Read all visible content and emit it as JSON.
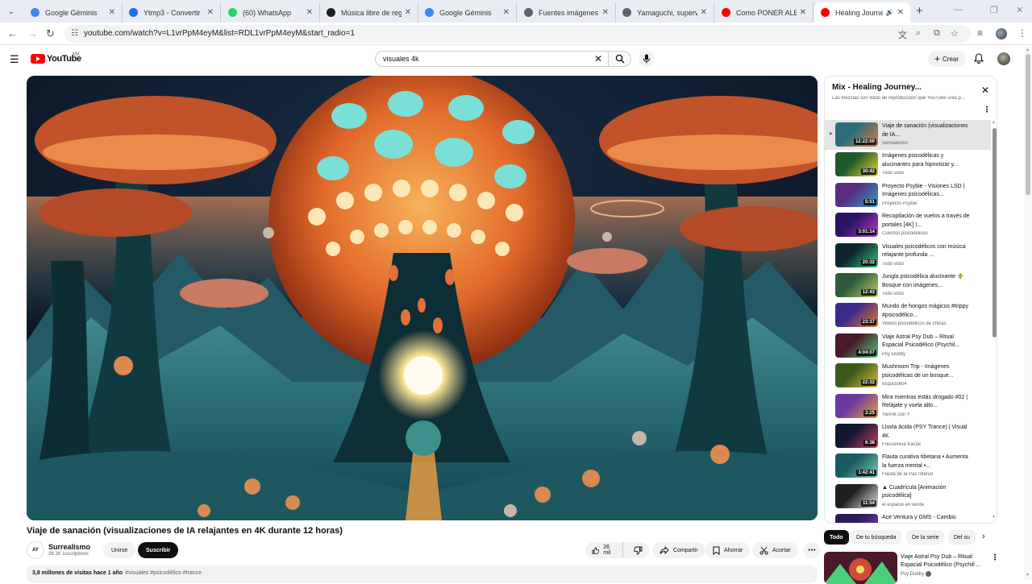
{
  "browser": {
    "tabs": [
      {
        "title": "Google Géminis",
        "color": "#4285f4"
      },
      {
        "title": "Ytmp3 - Convertir",
        "color": "#1a73e8"
      },
      {
        "title": "(60) WhatsApp",
        "color": "#25d366"
      },
      {
        "title": "Música libre de regal",
        "color": "#1f1f1f"
      },
      {
        "title": "Google Géminis",
        "color": "#4285f4"
      },
      {
        "title": "Fuentes imágenes Te",
        "color": "#5f6368"
      },
      {
        "title": "Yamaguchi, supervivie",
        "color": "#5f6368"
      },
      {
        "title": "Como PONER ALERTA",
        "color": "#ff0000"
      },
      {
        "title": "Healing Journey",
        "color": "#ff0000",
        "active": true
      }
    ],
    "url": "youtube.com/watch?v=L1vrPpM4eyM&list=RDL1vrPpM4eyM&start_radio=1"
  },
  "masthead": {
    "logo_text": "YouTube",
    "country": "MX",
    "search_value": "visuales 4k",
    "create_label": "Crear"
  },
  "video": {
    "title": "Viaje de sanación (visualizaciones de IA relajantes en 4K durante 12 horas)",
    "channel": "Surrealismo",
    "channel_logo_text": "AY",
    "subscribers": "38.1K suscriptores",
    "join_label": "Unirse",
    "subscribe_label": "Suscribir",
    "likes": "26 mil",
    "share_label": "Compartir",
    "save_label": "Ahorrar",
    "clip_label": "Acortar",
    "views_date": "3,8 millones de visitas hace 1 año",
    "tags": "#visuales #psicodélico #trance"
  },
  "playlist": {
    "title": "Mix - Healing Journey...",
    "subtitle": "Las mezclas son listas de reproducción que YouTube crea p...",
    "items": [
      {
        "title": "Viaje de sanación (visualizaciones de IA...",
        "channel": "Surrealismo",
        "duration": "12:22:00",
        "current": true,
        "c1": "#2b6f7a",
        "c2": "#e0793a"
      },
      {
        "title": "Imágenes psicodélicas y alucinantes para hipnotizar y...",
        "channel": "Todo visto",
        "duration": "30:42",
        "c1": "#1f5a2c",
        "c2": "#e8d83a"
      },
      {
        "title": "Proyecto Psybie - Visiones LSD | Imágenes psicodélicas...",
        "channel": "Proyecto Psybie",
        "duration": "5:51",
        "c1": "#5a2d82",
        "c2": "#27a3c6"
      },
      {
        "title": "Recopilación de vuelos a través de portales [4K] I...",
        "channel": "Cuentos psicodélicos",
        "duration": "3:01:14",
        "c1": "#2c1462",
        "c2": "#c13ad0"
      },
      {
        "title": "Visuales psicodélicos con música relajante profunda ...",
        "channel": "Todo visto",
        "duration": "20:32",
        "c1": "#0d2630",
        "c2": "#39c27a"
      },
      {
        "title": "Jungla psicodélica alucinante 🌵 Bosque con imágenes...",
        "channel": "Todo visto",
        "duration": "12:43",
        "c1": "#2e5b3a",
        "c2": "#b8d46a"
      },
      {
        "title": "Mundo de hongos mágicos #trippy #psicodélico...",
        "channel": "Videos psicodélicos de chicas",
        "duration": "23:37",
        "c1": "#3b2a8a",
        "c2": "#f07a2a"
      },
      {
        "title": "Viaje Astral Psy Dub – Ritual Espacial Psicodélico (Psychil...",
        "channel": "Psy Dubby",
        "duration": "4:04:07",
        "c1": "#4a1a2a",
        "c2": "#4ad07a"
      },
      {
        "title": "Mushroom Trip - Imágenes psicodélicas de un bosque...",
        "channel": "esquizo604",
        "duration": "22:32",
        "c1": "#3a5a1a",
        "c2": "#e0c040"
      },
      {
        "title": "Mira mientras estás drogado #02 | Relájate y vuela alto...",
        "channel": "Yannik con Y",
        "duration": "3:25",
        "c1": "#6a3aa0",
        "c2": "#f0a040"
      },
      {
        "title": "Lluvia ácida (PSY Trance) | Visual 4K",
        "channel": "Frecuencia fractal",
        "duration": "6:38",
        "c1": "#101830",
        "c2": "#d03a6a"
      },
      {
        "title": "Flauta curativa tibetana • Aumenta la fuerza mental •...",
        "channel": "Flauta de la Paz Interior",
        "duration": "1:42:41",
        "c1": "#1a5a60",
        "c2": "#7ad0c0"
      },
      {
        "title": "▲ Cuadrícula [Animación psicodélica]",
        "channel": "el espacio en verde",
        "duration": "11:54",
        "c1": "#202020",
        "c2": "#e8e8e8"
      },
      {
        "title": "Ace Ventura y GMS - Cambio",
        "channel": "",
        "duration": "",
        "c1": "#2a1a5a",
        "c2": "#8a3ad0"
      }
    ]
  },
  "chips": [
    "Todo",
    "De tu búsqueda",
    "De la serie",
    "Del su"
  ],
  "recommendation": {
    "title": "Viaje Astral Psy Dub – Ritual Espacial Psicodélico (Psychill ...",
    "channel": "Psy Dubby"
  },
  "colors": {
    "brand_red": "#ff0000",
    "text": "#0f0f0f",
    "secondary_text": "#606060",
    "chip_bg": "#f2f2f2"
  }
}
